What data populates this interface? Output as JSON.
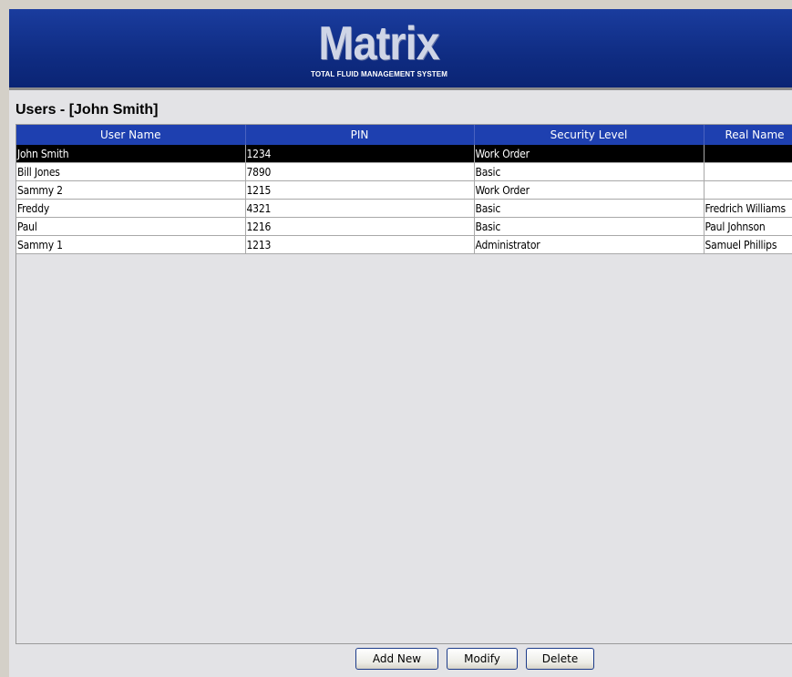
{
  "header": {
    "logo_word": "Matrix",
    "logo_tagline": "TOTAL FLUID MANAGEMENT SYSTEM"
  },
  "page": {
    "title": "Users -  [John Smith]"
  },
  "users_table": {
    "columns": [
      "User Name",
      "PIN",
      "Security Level",
      "Real Name"
    ],
    "rows": [
      {
        "user_name": "John Smith",
        "pin": "1234",
        "security_level": "Work Order",
        "real_name": ""
      },
      {
        "user_name": "Bill Jones",
        "pin": "7890",
        "security_level": "Basic",
        "real_name": ""
      },
      {
        "user_name": "Sammy 2",
        "pin": "1215",
        "security_level": "Work Order",
        "real_name": ""
      },
      {
        "user_name": "Freddy",
        "pin": "4321",
        "security_level": "Basic",
        "real_name": "Fredrich Williams"
      },
      {
        "user_name": "Paul",
        "pin": "1216",
        "security_level": "Basic",
        "real_name": "Paul Johnson"
      },
      {
        "user_name": "Sammy 1",
        "pin": "1213",
        "security_level": "Administrator",
        "real_name": "Samuel Phillips"
      }
    ],
    "selected_row": 0
  },
  "actions": {
    "add_new": "Add New",
    "modify": "Modify",
    "delete": "Delete"
  },
  "colors": {
    "banner": "#0f2c82",
    "header_row": "#1e40b0",
    "selected_row": "#000000",
    "background": "#e3e3e6"
  }
}
